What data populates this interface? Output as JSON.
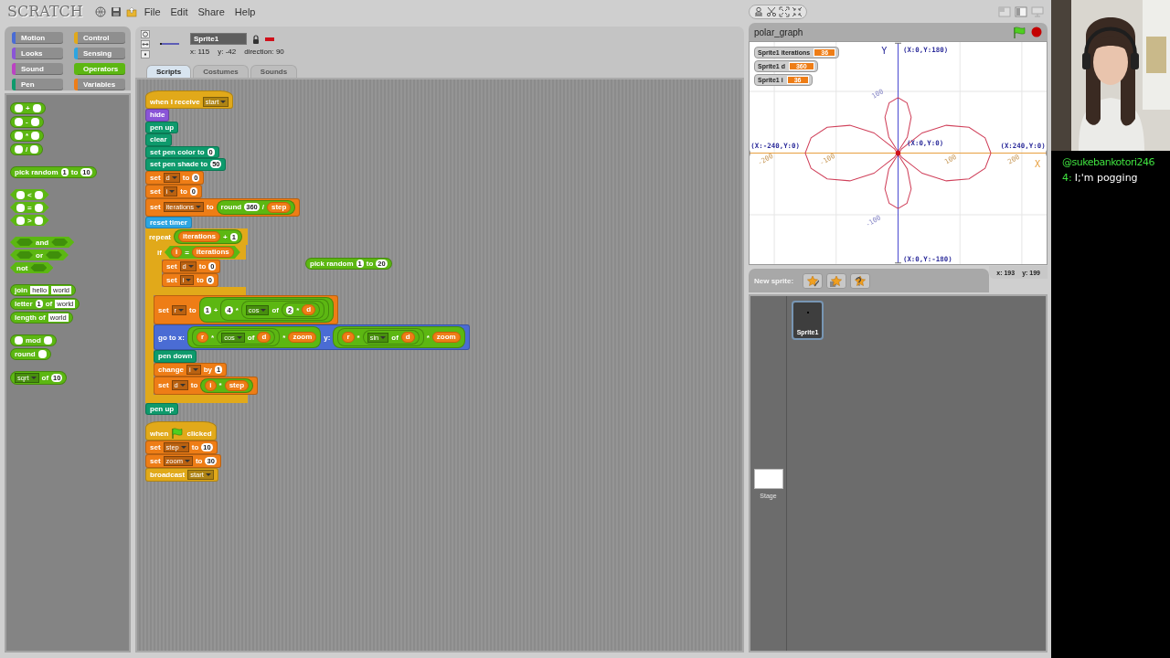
{
  "menubar": {
    "logo": "SCRATCH",
    "menus": [
      "File",
      "Edit",
      "Share",
      "Help"
    ]
  },
  "categories": [
    {
      "label": "Motion",
      "color": "#4a6cd4",
      "selected": false
    },
    {
      "label": "Control",
      "color": "#e1a91a",
      "selected": false
    },
    {
      "label": "Looks",
      "color": "#8a55d7",
      "selected": false
    },
    {
      "label": "Sensing",
      "color": "#2ca5e2",
      "selected": false
    },
    {
      "label": "Sound",
      "color": "#bb42c3",
      "selected": false
    },
    {
      "label": "Operators",
      "color": "#5cb712",
      "selected": true
    },
    {
      "label": "Pen",
      "color": "#0e9a6c",
      "selected": false
    },
    {
      "label": "Variables",
      "color": "#ee7d16",
      "selected": false
    }
  ],
  "palette": {
    "groups": [
      [
        {
          "kind": "reporter",
          "color": "#5cb712",
          "parts": [
            {
              "kind": "slot"
            },
            {
              "kind": "label",
              "text": "+"
            },
            {
              "kind": "slot"
            }
          ]
        },
        {
          "kind": "reporter",
          "color": "#5cb712",
          "parts": [
            {
              "kind": "slot"
            },
            {
              "kind": "label",
              "text": "-"
            },
            {
              "kind": "slot"
            }
          ]
        },
        {
          "kind": "reporter",
          "color": "#5cb712",
          "parts": [
            {
              "kind": "slot"
            },
            {
              "kind": "label",
              "text": "*"
            },
            {
              "kind": "slot"
            }
          ]
        },
        {
          "kind": "reporter",
          "color": "#5cb712",
          "parts": [
            {
              "kind": "slot"
            },
            {
              "kind": "label",
              "text": "/"
            },
            {
              "kind": "slot"
            }
          ]
        }
      ],
      [
        {
          "kind": "reporter",
          "color": "#5cb712",
          "parts": [
            {
              "kind": "label",
              "text": "pick random"
            },
            {
              "kind": "num",
              "text": "1"
            },
            {
              "kind": "label",
              "text": "to"
            },
            {
              "kind": "num",
              "text": "10"
            }
          ]
        }
      ],
      [
        {
          "kind": "boolean",
          "color": "#5cb712",
          "parts": [
            {
              "kind": "slot"
            },
            {
              "kind": "label",
              "text": "<"
            },
            {
              "kind": "slot"
            }
          ]
        },
        {
          "kind": "boolean",
          "color": "#5cb712",
          "parts": [
            {
              "kind": "slot"
            },
            {
              "kind": "label",
              "text": "="
            },
            {
              "kind": "slot"
            }
          ]
        },
        {
          "kind": "boolean",
          "color": "#5cb712",
          "parts": [
            {
              "kind": "slot"
            },
            {
              "kind": "label",
              "text": ">"
            },
            {
              "kind": "slot"
            }
          ]
        }
      ],
      [
        {
          "kind": "boolean",
          "color": "#5cb712",
          "parts": [
            {
              "kind": "hexslot"
            },
            {
              "kind": "label",
              "text": "and"
            },
            {
              "kind": "hexslot"
            }
          ]
        },
        {
          "kind": "boolean",
          "color": "#5cb712",
          "parts": [
            {
              "kind": "hexslot"
            },
            {
              "kind": "label",
              "text": "or"
            },
            {
              "kind": "hexslot"
            }
          ]
        },
        {
          "kind": "boolean",
          "color": "#5cb712",
          "parts": [
            {
              "kind": "label",
              "text": "not"
            },
            {
              "kind": "hexslot"
            }
          ]
        }
      ],
      [
        {
          "kind": "reporter",
          "color": "#5cb712",
          "parts": [
            {
              "kind": "label",
              "text": "join"
            },
            {
              "kind": "text",
              "text": "hello"
            },
            {
              "kind": "text",
              "text": "world"
            }
          ]
        },
        {
          "kind": "reporter",
          "color": "#5cb712",
          "parts": [
            {
              "kind": "label",
              "text": "letter"
            },
            {
              "kind": "num",
              "text": "1"
            },
            {
              "kind": "label",
              "text": "of"
            },
            {
              "kind": "text",
              "text": "world"
            }
          ]
        },
        {
          "kind": "reporter",
          "color": "#5cb712",
          "parts": [
            {
              "kind": "label",
              "text": "length of"
            },
            {
              "kind": "text",
              "text": "world"
            }
          ]
        }
      ],
      [
        {
          "kind": "reporter",
          "color": "#5cb712",
          "parts": [
            {
              "kind": "slot"
            },
            {
              "kind": "label",
              "text": "mod"
            },
            {
              "kind": "slot"
            }
          ]
        },
        {
          "kind": "reporter",
          "color": "#5cb712",
          "parts": [
            {
              "kind": "label",
              "text": "round"
            },
            {
              "kind": "slot"
            }
          ]
        }
      ],
      [
        {
          "kind": "reporter",
          "color": "#5cb712",
          "parts": [
            {
              "kind": "menu",
              "text": "sqrt"
            },
            {
              "kind": "label",
              "text": "of"
            },
            {
              "kind": "num",
              "text": "10"
            }
          ]
        }
      ]
    ]
  },
  "sprite_info": {
    "name": "Sprite1",
    "x": "x: 115",
    "y": "y: -42",
    "direction": "direction: 90"
  },
  "tabs": [
    {
      "label": "Scripts",
      "selected": true
    },
    {
      "label": "Costumes",
      "selected": false
    },
    {
      "label": "Sounds",
      "selected": false
    }
  ],
  "scripts": [
    {
      "blocks": [
        {
          "kind": "hat",
          "color": "#e1a91a",
          "parts": [
            {
              "kind": "label",
              "text": "when I receive"
            },
            {
              "kind": "menu",
              "text": "start"
            }
          ]
        },
        {
          "kind": "stack",
          "color": "#8a55d7",
          "parts": [
            {
              "kind": "label",
              "text": "hide"
            }
          ]
        },
        {
          "kind": "stack",
          "color": "#0e9a6c",
          "parts": [
            {
              "kind": "label",
              "text": "pen up"
            }
          ]
        },
        {
          "kind": "stack",
          "color": "#0e9a6c",
          "parts": [
            {
              "kind": "label",
              "text": "clear"
            }
          ]
        },
        {
          "kind": "stack",
          "color": "#0e9a6c",
          "parts": [
            {
              "kind": "label",
              "text": "set pen color to"
            },
            {
              "kind": "num",
              "text": "0"
            }
          ]
        },
        {
          "kind": "stack",
          "color": "#0e9a6c",
          "parts": [
            {
              "kind": "label",
              "text": "set pen shade to"
            },
            {
              "kind": "num",
              "text": "50"
            }
          ]
        },
        {
          "kind": "stack",
          "color": "#ee7d16",
          "parts": [
            {
              "kind": "label",
              "text": "set"
            },
            {
              "kind": "menu",
              "text": "d"
            },
            {
              "kind": "label",
              "text": "to"
            },
            {
              "kind": "num",
              "text": "0"
            }
          ]
        },
        {
          "kind": "stack",
          "color": "#ee7d16",
          "parts": [
            {
              "kind": "label",
              "text": "set"
            },
            {
              "kind": "menu",
              "text": "i"
            },
            {
              "kind": "label",
              "text": "to"
            },
            {
              "kind": "num",
              "text": "0"
            }
          ]
        },
        {
          "kind": "stack",
          "color": "#ee7d16",
          "parts": [
            {
              "kind": "label",
              "text": "set"
            },
            {
              "kind": "menu",
              "text": "iterations"
            },
            {
              "kind": "label",
              "text": "to"
            },
            {
              "kind": "reporter",
              "color": "#5cb712",
              "parts": [
                {
                  "kind": "label",
                  "text": "round"
                },
                {
                  "kind": "num",
                  "text": "360"
                },
                {
                  "kind": "label",
                  "text": "/"
                },
                {
                  "kind": "var",
                  "text": "step"
                }
              ]
            }
          ]
        },
        {
          "kind": "stack",
          "color": "#2ca5e2",
          "parts": [
            {
              "kind": "label",
              "text": "reset timer"
            }
          ]
        },
        {
          "kind": "c",
          "color": "#e1a91a",
          "parts": [
            {
              "kind": "label",
              "text": "repeat"
            },
            {
              "kind": "reporter",
              "color": "#5cb712",
              "parts": [
                {
                  "kind": "var",
                  "text": "iterations"
                },
                {
                  "kind": "label",
                  "text": "+"
                },
                {
                  "kind": "num",
                  "text": "1"
                }
              ]
            }
          ],
          "children": [
            {
              "kind": "c",
              "color": "#e1a91a",
              "parts": [
                {
                  "kind": "label",
                  "text": "if"
                },
                {
                  "kind": "boolean",
                  "color": "#5cb712",
                  "parts": [
                    {
                      "kind": "var",
                      "text": "i"
                    },
                    {
                      "kind": "label",
                      "text": "="
                    },
                    {
                      "kind": "var",
                      "text": "iterations"
                    }
                  ]
                }
              ],
              "children": [
                {
                  "kind": "stack",
                  "color": "#ee7d16",
                  "parts": [
                    {
                      "kind": "label",
                      "text": "set"
                    },
                    {
                      "kind": "menu",
                      "text": "d"
                    },
                    {
                      "kind": "label",
                      "text": "to"
                    },
                    {
                      "kind": "num",
                      "text": "0"
                    }
                  ]
                },
                {
                  "kind": "stack",
                  "color": "#ee7d16",
                  "parts": [
                    {
                      "kind": "label",
                      "text": "set"
                    },
                    {
                      "kind": "menu",
                      "text": "i"
                    },
                    {
                      "kind": "label",
                      "text": "to"
                    },
                    {
                      "kind": "num",
                      "text": "0"
                    }
                  ]
                }
              ]
            },
            {
              "kind": "stack",
              "color": "#ee7d16",
              "parts": [
                {
                  "kind": "label",
                  "text": "set"
                },
                {
                  "kind": "menu",
                  "text": "r"
                },
                {
                  "kind": "label",
                  "text": "to"
                },
                {
                  "kind": "reporter",
                  "color": "#5cb712",
                  "parts": [
                    {
                      "kind": "num",
                      "text": "1"
                    },
                    {
                      "kind": "label",
                      "text": "+"
                    },
                    {
                      "kind": "reporter",
                      "color": "#5cb712",
                      "parts": [
                        {
                          "kind": "num",
                          "text": "4"
                        },
                        {
                          "kind": "label",
                          "text": "*"
                        },
                        {
                          "kind": "reporter",
                          "color": "#5cb712",
                          "parts": [
                            {
                              "kind": "menu",
                              "text": "cos"
                            },
                            {
                              "kind": "label",
                              "text": "of"
                            },
                            {
                              "kind": "reporter",
                              "color": "#5cb712",
                              "parts": [
                                {
                                  "kind": "num",
                                  "text": "2"
                                },
                                {
                                  "kind": "label",
                                  "text": "*"
                                },
                                {
                                  "kind": "var",
                                  "text": "d"
                                }
                              ]
                            }
                          ]
                        }
                      ]
                    }
                  ]
                }
              ]
            },
            {
              "kind": "stack",
              "color": "#4a6cd4",
              "parts": [
                {
                  "kind": "label",
                  "text": "go to x:"
                },
                {
                  "kind": "reporter",
                  "color": "#5cb712",
                  "parts": [
                    {
                      "kind": "reporter",
                      "color": "#5cb712",
                      "parts": [
                        {
                          "kind": "var",
                          "text": "r"
                        },
                        {
                          "kind": "label",
                          "text": "*"
                        },
                        {
                          "kind": "reporter",
                          "color": "#5cb712",
                          "parts": [
                            {
                              "kind": "menu",
                              "text": "cos"
                            },
                            {
                              "kind": "label",
                              "text": "of"
                            },
                            {
                              "kind": "var",
                              "text": "d"
                            }
                          ]
                        }
                      ]
                    },
                    {
                      "kind": "label",
                      "text": "*"
                    },
                    {
                      "kind": "var",
                      "text": "zoom"
                    }
                  ]
                },
                {
                  "kind": "label",
                  "text": "y:"
                },
                {
                  "kind": "reporter",
                  "color": "#5cb712",
                  "parts": [
                    {
                      "kind": "reporter",
                      "color": "#5cb712",
                      "parts": [
                        {
                          "kind": "var",
                          "text": "r"
                        },
                        {
                          "kind": "label",
                          "text": "*"
                        },
                        {
                          "kind": "reporter",
                          "color": "#5cb712",
                          "parts": [
                            {
                              "kind": "menu",
                              "text": "sin"
                            },
                            {
                              "kind": "label",
                              "text": "of"
                            },
                            {
                              "kind": "var",
                              "text": "d"
                            }
                          ]
                        }
                      ]
                    },
                    {
                      "kind": "label",
                      "text": "*"
                    },
                    {
                      "kind": "var",
                      "text": "zoom"
                    }
                  ]
                }
              ]
            },
            {
              "kind": "stack",
              "color": "#0e9a6c",
              "parts": [
                {
                  "kind": "label",
                  "text": "pen down"
                }
              ]
            },
            {
              "kind": "stack",
              "color": "#ee7d16",
              "parts": [
                {
                  "kind": "label",
                  "text": "change"
                },
                {
                  "kind": "menu",
                  "text": "i"
                },
                {
                  "kind": "label",
                  "text": "by"
                },
                {
                  "kind": "num",
                  "text": "1"
                }
              ]
            },
            {
              "kind": "stack",
              "color": "#ee7d16",
              "parts": [
                {
                  "kind": "label",
                  "text": "set"
                },
                {
                  "kind": "menu",
                  "text": "d"
                },
                {
                  "kind": "label",
                  "text": "to"
                },
                {
                  "kind": "reporter",
                  "color": "#5cb712",
                  "parts": [
                    {
                      "kind": "var",
                      "text": "i"
                    },
                    {
                      "kind": "label",
                      "text": "*"
                    },
                    {
                      "kind": "var",
                      "text": "step"
                    }
                  ]
                }
              ]
            }
          ]
        },
        {
          "kind": "stack",
          "color": "#0e9a6c",
          "parts": [
            {
              "kind": "label",
              "text": "pen up"
            }
          ]
        }
      ]
    },
    {
      "blocks": [
        {
          "kind": "reporter",
          "color": "#5cb712",
          "parts": [
            {
              "kind": "label",
              "text": "pick random"
            },
            {
              "kind": "num",
              "text": "1"
            },
            {
              "kind": "label",
              "text": "to"
            },
            {
              "kind": "num",
              "text": "20"
            }
          ]
        }
      ]
    },
    {
      "blocks": [
        {
          "kind": "hat",
          "color": "#e1a91a",
          "parts": [
            {
              "kind": "label",
              "text": "when"
            },
            {
              "kind": "flag"
            },
            {
              "kind": "label",
              "text": "clicked"
            }
          ]
        },
        {
          "kind": "stack",
          "color": "#ee7d16",
          "parts": [
            {
              "kind": "label",
              "text": "set"
            },
            {
              "kind": "menu",
              "text": "step"
            },
            {
              "kind": "label",
              "text": "to"
            },
            {
              "kind": "num",
              "text": "10"
            }
          ]
        },
        {
          "kind": "stack",
          "color": "#ee7d16",
          "parts": [
            {
              "kind": "label",
              "text": "set"
            },
            {
              "kind": "menu",
              "text": "zoom"
            },
            {
              "kind": "label",
              "text": "to"
            },
            {
              "kind": "num",
              "text": "30"
            }
          ]
        },
        {
          "kind": "stack",
          "color": "#e1a91a",
          "parts": [
            {
              "kind": "label",
              "text": "broadcast"
            },
            {
              "kind": "menu",
              "text": "start"
            }
          ]
        }
      ]
    }
  ],
  "stage": {
    "title": "polar_graph",
    "monitors": [
      {
        "label": "Sprite1 iterations",
        "value": "36"
      },
      {
        "label": "Sprite1 d",
        "value": "360"
      },
      {
        "label": "Sprite1 i",
        "value": "36"
      }
    ],
    "labels": [
      {
        "kind": "yaxis",
        "text": "Y"
      },
      {
        "kind": "coord",
        "text": "(X:0,Y:180)"
      },
      {
        "kind": "ytick",
        "text": "100"
      },
      {
        "kind": "coord",
        "text": "(X:-240,Y:0)"
      },
      {
        "kind": "coord",
        "text": "(X:0,Y:0)"
      },
      {
        "kind": "coord",
        "text": "(X:240,Y:0)"
      },
      {
        "kind": "xtick",
        "text": "-200"
      },
      {
        "kind": "xtick",
        "text": "-100"
      },
      {
        "kind": "xtick",
        "text": "100"
      },
      {
        "kind": "xtick",
        "text": "200"
      },
      {
        "kind": "xaxis",
        "text": "X"
      },
      {
        "kind": "ytick",
        "text": "-100"
      },
      {
        "kind": "coord",
        "text": "(X:0,Y:-180)"
      }
    ],
    "mouse_x": "x: 193",
    "mouse_y": "y: 199"
  },
  "new_sprite": {
    "label": "New sprite:"
  },
  "sprites": [
    {
      "name": "Sprite1",
      "selected": true
    }
  ],
  "stage_thumb": {
    "label": "Stage"
  },
  "chat": {
    "user": "@sukebankotori246",
    "prefix": "4:",
    "message": "I;'m pogging"
  }
}
